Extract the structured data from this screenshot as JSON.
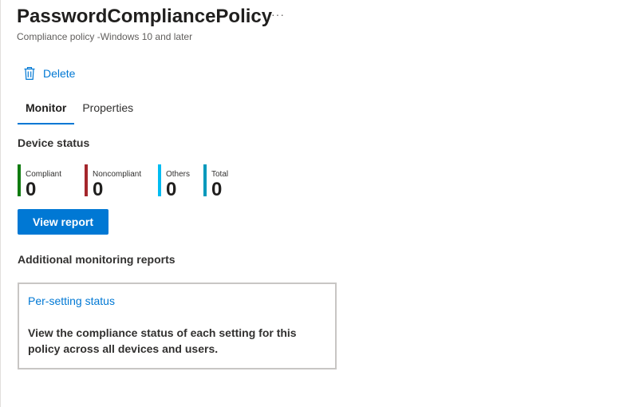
{
  "header": {
    "title": "PasswordCompliancePolicy",
    "more_label": "···",
    "subtitle": "Compliance policy -Windows 10 and later"
  },
  "toolbar": {
    "delete_label": "Delete",
    "delete_icon": "trash-icon"
  },
  "tabs": [
    {
      "label": "Monitor",
      "active": true
    },
    {
      "label": "Properties",
      "active": false
    }
  ],
  "device_status": {
    "title": "Device status",
    "stats": [
      {
        "label": "Compliant",
        "value": "0",
        "color": "#107c10"
      },
      {
        "label": "Noncompliant",
        "value": "0",
        "color": "#a4262c"
      },
      {
        "label": "Others",
        "value": "0",
        "color": "#00bcf2"
      },
      {
        "label": "Total",
        "value": "0",
        "color": "#0099bc"
      }
    ],
    "view_report_label": "View report"
  },
  "additional_reports": {
    "title": "Additional monitoring reports",
    "cards": [
      {
        "link": "Per-setting status",
        "description": "View the compliance status of each setting for this policy across all devices and users."
      }
    ]
  },
  "colors": {
    "accent": "#0078d4"
  }
}
